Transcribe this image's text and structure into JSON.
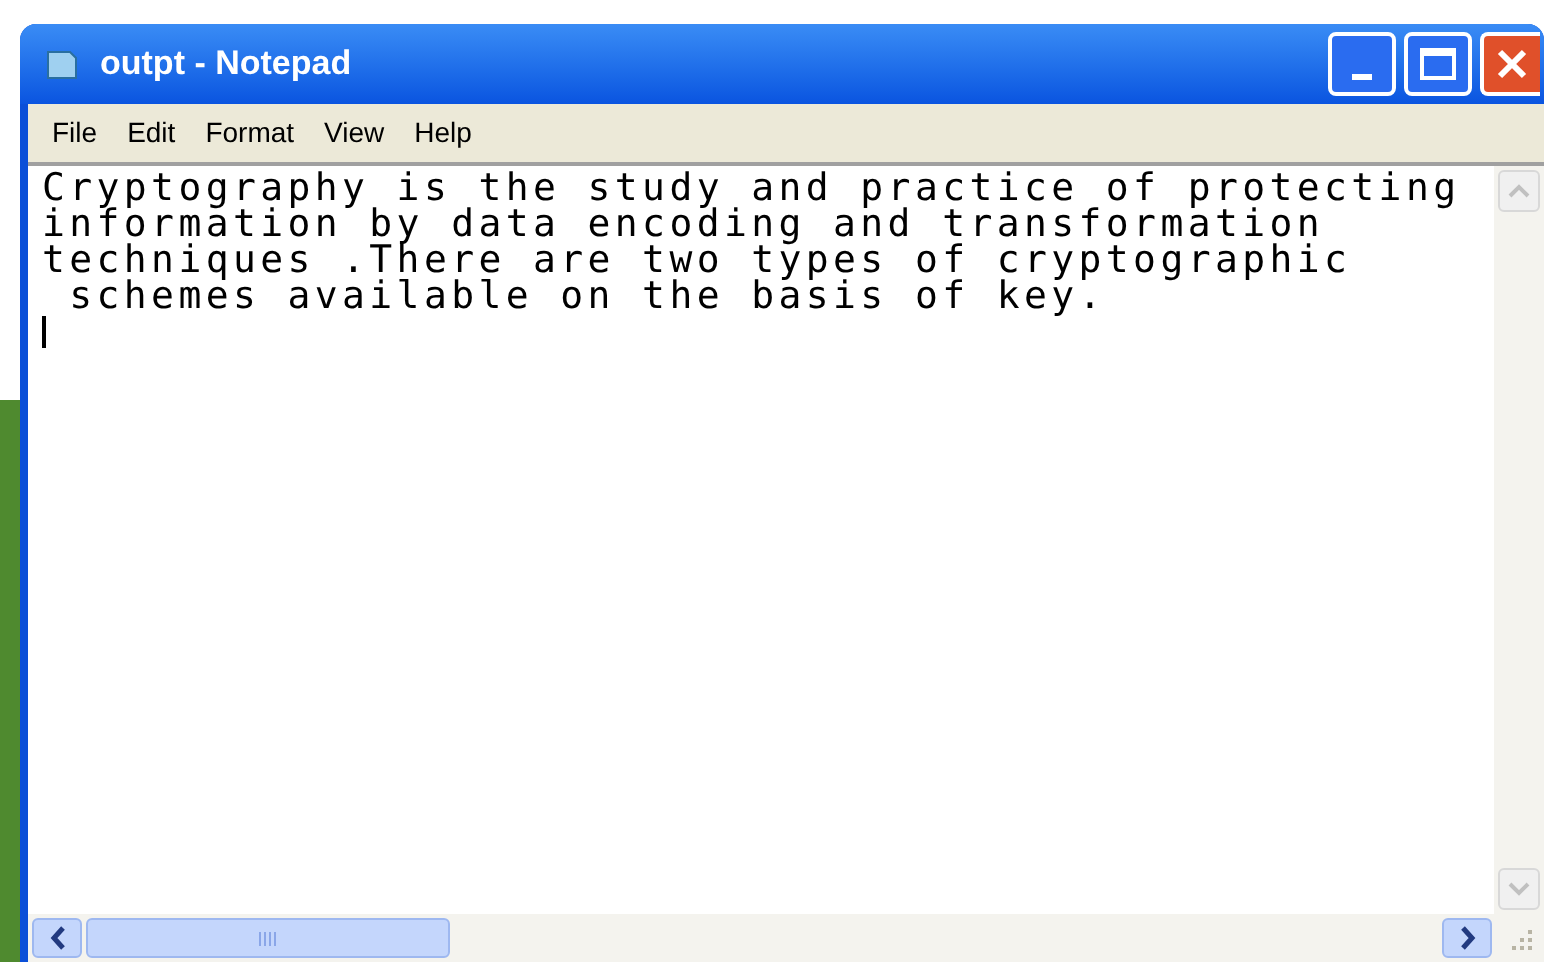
{
  "window": {
    "title": "outpt - Notepad"
  },
  "menu": [
    "File",
    "Edit",
    "Format",
    "View",
    "Help"
  ],
  "editor": {
    "lines": [
      "Cryptography is the study and practice of protecting",
      "information by data encoding and transformation",
      "techniques .There are two types of cryptographic",
      " schemes available on the basis of key."
    ]
  }
}
